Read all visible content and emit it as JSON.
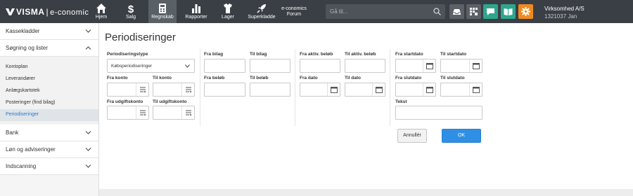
{
  "brand": {
    "logo": "VISMA",
    "separator": "|",
    "product": "e-conomic"
  },
  "nav": [
    {
      "label": "Hjem",
      "icon": "home-icon"
    },
    {
      "label": "Salg",
      "icon": "dollar-icon"
    },
    {
      "label": "Regnskab",
      "icon": "calculator-icon",
      "active": true
    },
    {
      "label": "Rapporter",
      "icon": "bar-chart-icon"
    },
    {
      "label": "Lager",
      "icon": "hanger-icon"
    },
    {
      "label": "Superkladde",
      "icon": "rocket-icon"
    },
    {
      "label_line1": "e-conomics",
      "label_line2": "Forum"
    }
  ],
  "search": {
    "placeholder": "Gå til..."
  },
  "toolbar_icons": [
    "inbox-icon",
    "apps-icon",
    "chat-icon",
    "book-icon",
    "gear-icon"
  ],
  "company": {
    "name": "Virksomhed A/S",
    "sub": "1321037 Jan"
  },
  "sidebar": {
    "sections": [
      {
        "label": "Kassekladder",
        "expanded": false
      },
      {
        "label": "Søgning og lister",
        "expanded": true
      },
      {
        "label": "Bank",
        "expanded": false
      },
      {
        "label": "Løn og adviseringer",
        "expanded": false
      },
      {
        "label": "Indscanning",
        "expanded": false
      }
    ],
    "sub_items": [
      {
        "label": "Kontoplan"
      },
      {
        "label": "Leverandører"
      },
      {
        "label": "Anlægskartotek"
      },
      {
        "label": "Posteringer (find bilag)"
      },
      {
        "label": "Periodiseringer",
        "selected": true
      }
    ]
  },
  "page": {
    "title": "Periodiseringer"
  },
  "form": {
    "periodiseringstype": {
      "label": "Periodiseringstype",
      "value": "Købsperiodiseringer"
    },
    "fra_konto": "Fra konto",
    "til_konto": "Til konto",
    "fra_udgiftskonto": "Fra udgiftskonto",
    "til_udgiftskonto": "Til udgiftskonto",
    "fra_bilag": "Fra bilag",
    "til_bilag": "Til bilag",
    "fra_beloeb": "Fra beløb",
    "til_beloeb": "Til beløb",
    "fra_aktiv_beloeb": "Fra aktiv. beløb",
    "til_aktiv_beloeb": "Til aktiv. beløb",
    "fra_dato": "Fra dato",
    "til_dato": "Til dato",
    "fra_startdato": "Fra startdato",
    "til_startdato": "Til startdato",
    "fra_slutdato": "Fra slutdato",
    "til_slutdato": "Til slutdato",
    "tekst": "Tekst"
  },
  "buttons": {
    "cancel": "Annullér",
    "ok": "OK"
  },
  "colors": {
    "topbar": "#3a3f45",
    "accent_blue": "#2f8fe5",
    "teal": "#2fa58d",
    "orange": "#ef8a1f",
    "selected_link": "#2a7ad1"
  }
}
